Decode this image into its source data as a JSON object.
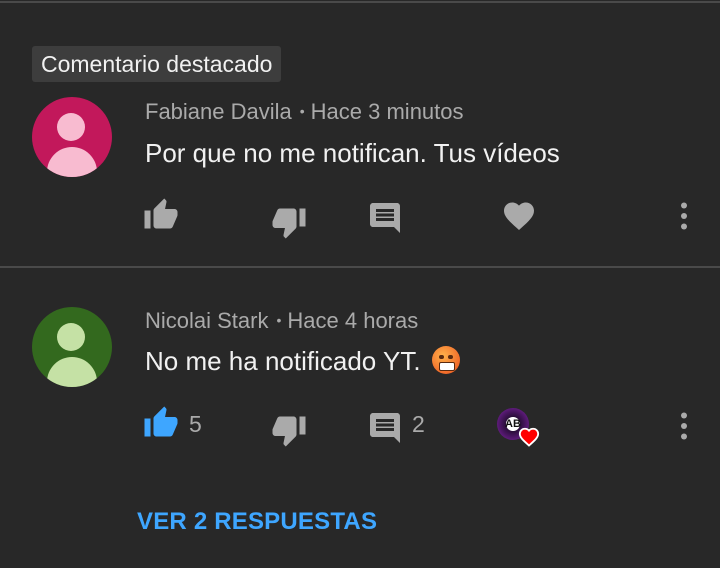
{
  "highlight": {
    "label": "Comentario destacado"
  },
  "comments": [
    {
      "author": "Fabiane Davila",
      "separator": "•",
      "time": "Hace 3 minutos",
      "text": "Por que no me notifican. Tus vídeos",
      "avatar_bg": "#c2185b",
      "avatar_fg": "#f8bbd0",
      "liked": false,
      "like_count": "",
      "reply_count": "",
      "icons": [
        "like-icon",
        "dislike-icon",
        "reply-icon",
        "heart-icon",
        "more-vert-icon"
      ]
    },
    {
      "author": "Nicolai Stark",
      "separator": "•",
      "time": "Hace 4 horas",
      "text": "No me ha notificado YT.",
      "emoji": "angry-face-emoji",
      "avatar_bg": "#33691e",
      "avatar_fg": "#c5e1a5",
      "liked": true,
      "like_count": "5",
      "reply_count": "2",
      "creator_badge_text": "AB",
      "icons": [
        "like-icon",
        "dislike-icon",
        "reply-icon",
        "creator-heart-icon",
        "more-vert-icon"
      ]
    }
  ],
  "replies": {
    "label": "VER 2 RESPUESTAS"
  },
  "colors": {
    "background": "#282828",
    "divider": "#4a4a4a",
    "icon": "#aaaaaa",
    "accent": "#3ea6ff",
    "creator_heart": "#ff0000"
  }
}
